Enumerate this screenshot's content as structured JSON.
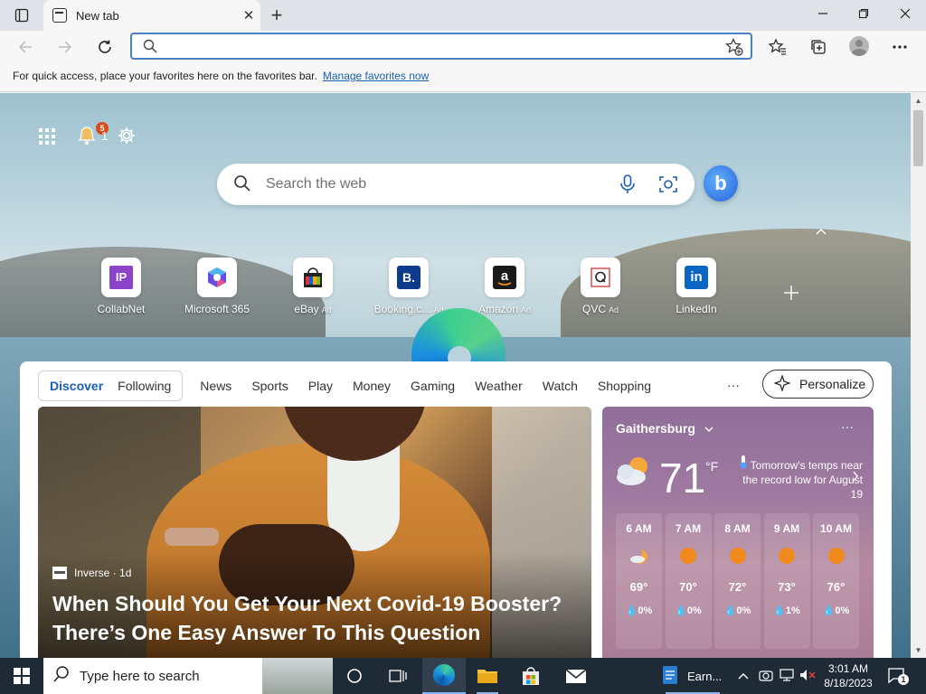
{
  "browser": {
    "tab_title": "New tab",
    "address_value": "",
    "favorites_hint": "For quick access, place your favorites here on the favorites bar.",
    "favorites_link": "Manage favorites now"
  },
  "ntp": {
    "notification_badge": "5",
    "notification_count": "1",
    "search_placeholder": "Search the web",
    "bing_label": "b",
    "tiles": [
      {
        "label": "CollabNet",
        "ad": "",
        "icon": "collabnet-icon"
      },
      {
        "label": "Microsoft 365",
        "ad": "",
        "icon": "microsoft-365-icon"
      },
      {
        "label": "eBay",
        "ad": "Ad",
        "icon": "ebay-icon"
      },
      {
        "label": "Booking.c...",
        "ad": "Ad",
        "icon": "booking-icon"
      },
      {
        "label": "Amazon",
        "ad": "Ad",
        "icon": "amazon-icon"
      },
      {
        "label": "QVC",
        "ad": "Ad",
        "icon": "qvc-icon"
      },
      {
        "label": "LinkedIn",
        "ad": "",
        "icon": "linkedin-icon"
      }
    ]
  },
  "feed": {
    "segments": [
      "Discover",
      "Following"
    ],
    "active_segment": "Discover",
    "nav": [
      "News",
      "Sports",
      "Play",
      "Money",
      "Gaming",
      "Weather",
      "Watch",
      "Shopping"
    ],
    "more": "···",
    "personalize": "Personalize",
    "article": {
      "source": "Inverse · 1d",
      "headline": "When Should You Get Your Next Covid-19 Booster? There’s One Easy Answer To This Question"
    }
  },
  "weather": {
    "location": "Gaithersburg",
    "more": "···",
    "temp": "71",
    "unit": "°F",
    "note": "Tomorrow's temps near the record low for August 19",
    "hourly": [
      {
        "time": "6 AM",
        "temp": "69°",
        "precip": "0%",
        "icon": "partly-cloudy-night-icon"
      },
      {
        "time": "7 AM",
        "temp": "70°",
        "precip": "0%",
        "icon": "sunny-icon"
      },
      {
        "time": "8 AM",
        "temp": "72°",
        "precip": "0%",
        "icon": "sunny-icon"
      },
      {
        "time": "9 AM",
        "temp": "73°",
        "precip": "1%",
        "icon": "sunny-icon"
      },
      {
        "time": "10 AM",
        "temp": "76°",
        "precip": "0%",
        "icon": "sunny-icon"
      }
    ]
  },
  "taskbar": {
    "search_placeholder": "Type here to search",
    "earn_label": "Earn...",
    "time": "3:01 AM",
    "date": "8/18/2023",
    "notification_count": "1"
  },
  "colors": {
    "accent": "#1a5fb4",
    "address_border": "#4a7fc1",
    "taskbar": "#1f2a37",
    "weather_card": "#a07aa0",
    "badge": "#d84a1b"
  }
}
